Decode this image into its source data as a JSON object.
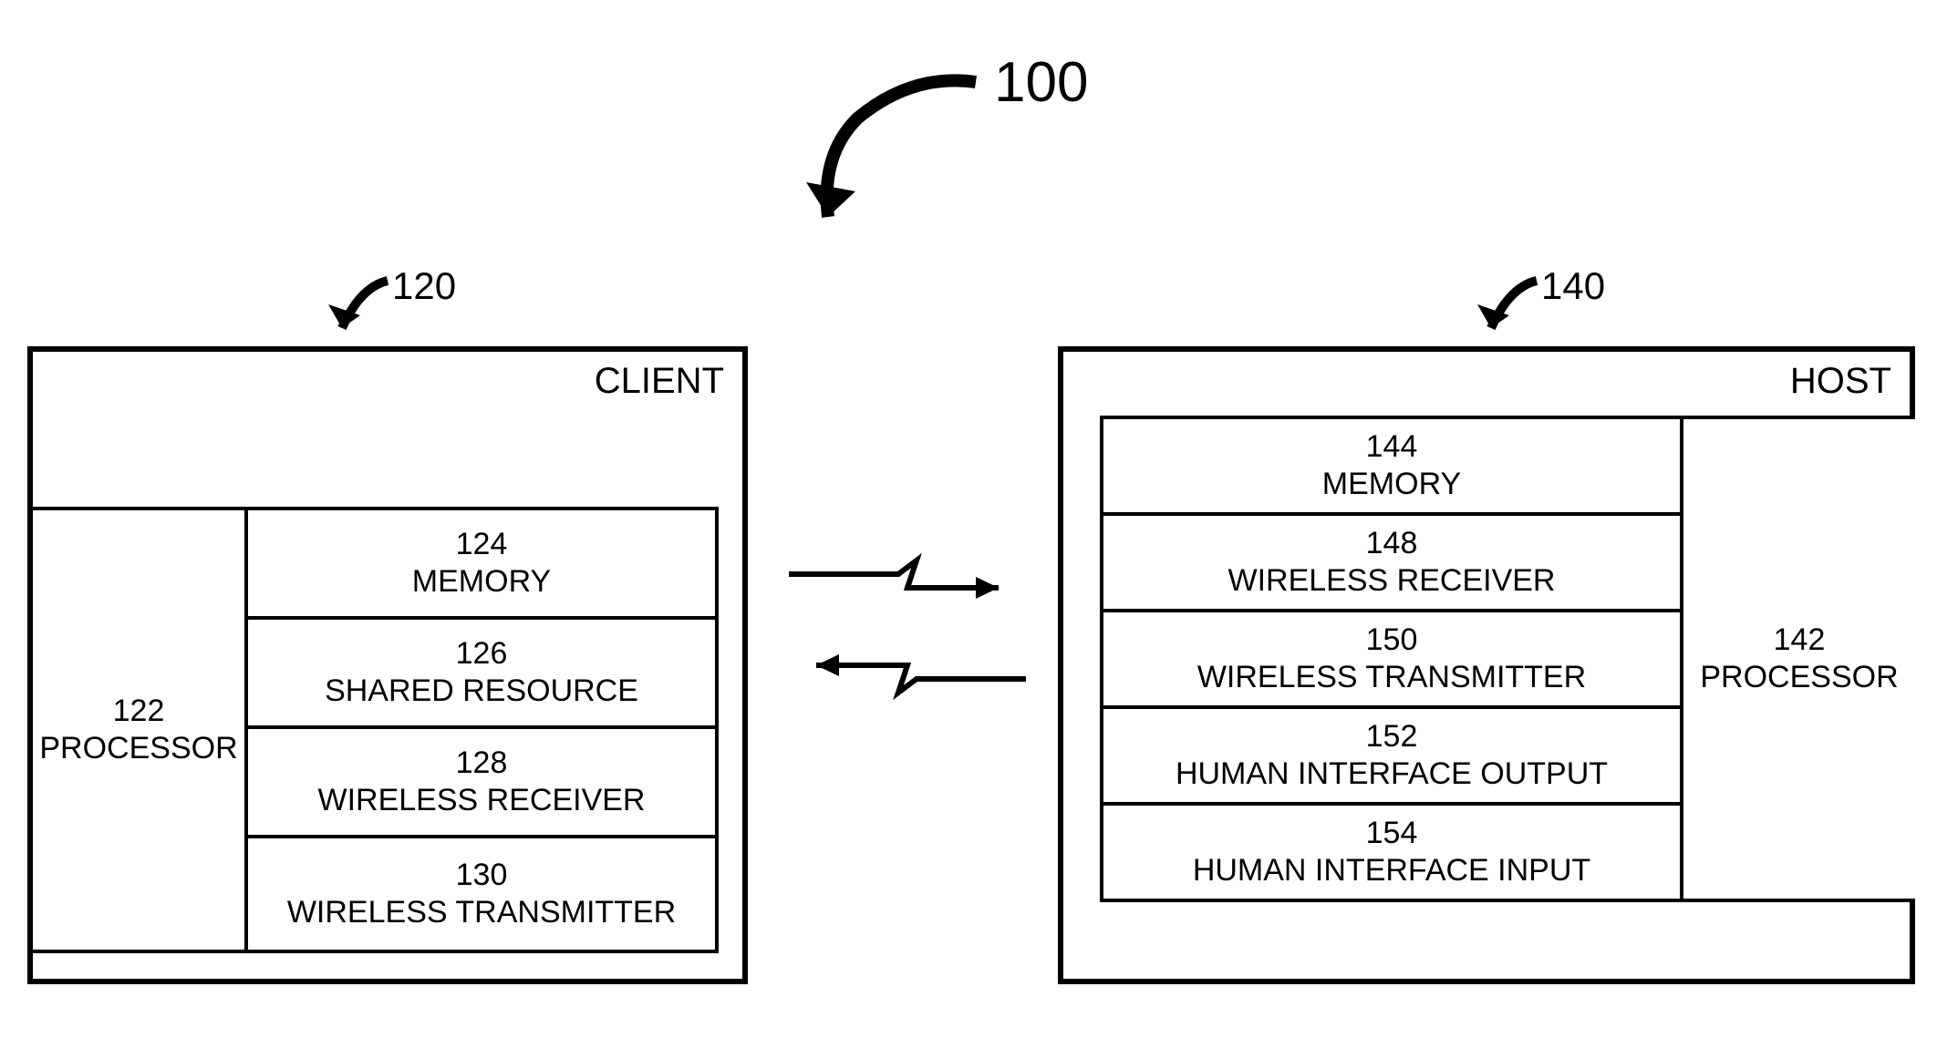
{
  "figure": {
    "main_ref": "100",
    "client_ref": "120",
    "host_ref": "140"
  },
  "client": {
    "title": "CLIENT",
    "processor": {
      "num": "122",
      "label": "PROCESSOR"
    },
    "components": [
      {
        "num": "124",
        "label": "MEMORY"
      },
      {
        "num": "126",
        "label": "SHARED RESOURCE"
      },
      {
        "num": "128",
        "label": "WIRELESS RECEIVER"
      },
      {
        "num": "130",
        "label": "WIRELESS TRANSMITTER"
      }
    ]
  },
  "host": {
    "title": "HOST",
    "processor": {
      "num": "142",
      "label": "PROCESSOR"
    },
    "components": [
      {
        "num": "144",
        "label": "MEMORY"
      },
      {
        "num": "148",
        "label": "WIRELESS RECEIVER"
      },
      {
        "num": "150",
        "label": "WIRELESS TRANSMITTER"
      },
      {
        "num": "152",
        "label": "HUMAN INTERFACE OUTPUT"
      },
      {
        "num": "154",
        "label": "HUMAN INTERFACE INPUT"
      }
    ]
  }
}
